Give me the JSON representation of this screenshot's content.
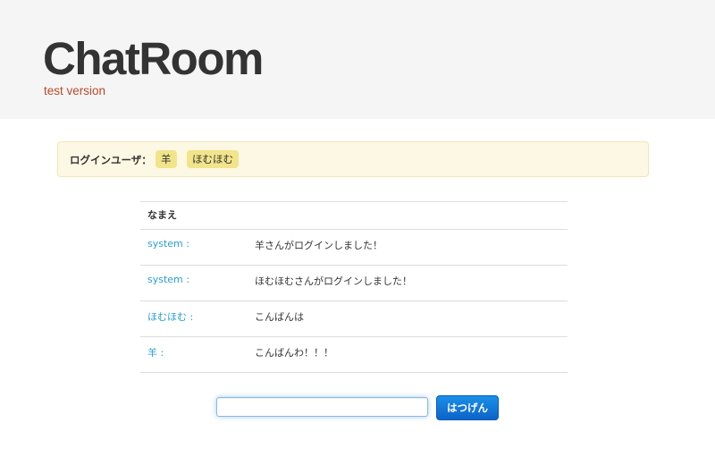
{
  "header": {
    "title": "ChatRoom",
    "subtitle": "test version"
  },
  "users": {
    "label": "ログインユーザ：",
    "list": [
      "羊",
      "ほむほむ"
    ]
  },
  "table": {
    "header_name": "なまえ",
    "header_message": "",
    "rows": [
      {
        "speaker": "system :",
        "message": "羊さんがログインしました！"
      },
      {
        "speaker": "system :",
        "message": "ほむほむさんがログインしました！"
      },
      {
        "speaker": "ほむほむ :",
        "message": "こんばんは"
      },
      {
        "speaker": "羊 :",
        "message": "こんばんわ！！！"
      }
    ]
  },
  "composer": {
    "input_value": "",
    "send_label": "はつげん"
  },
  "colors": {
    "speaker": "#2a9fd6",
    "subtitle": "#b94a2c",
    "alert_bg": "#fcf8e3",
    "badge_bg": "#f2e48a",
    "button": "#0d63c9"
  }
}
